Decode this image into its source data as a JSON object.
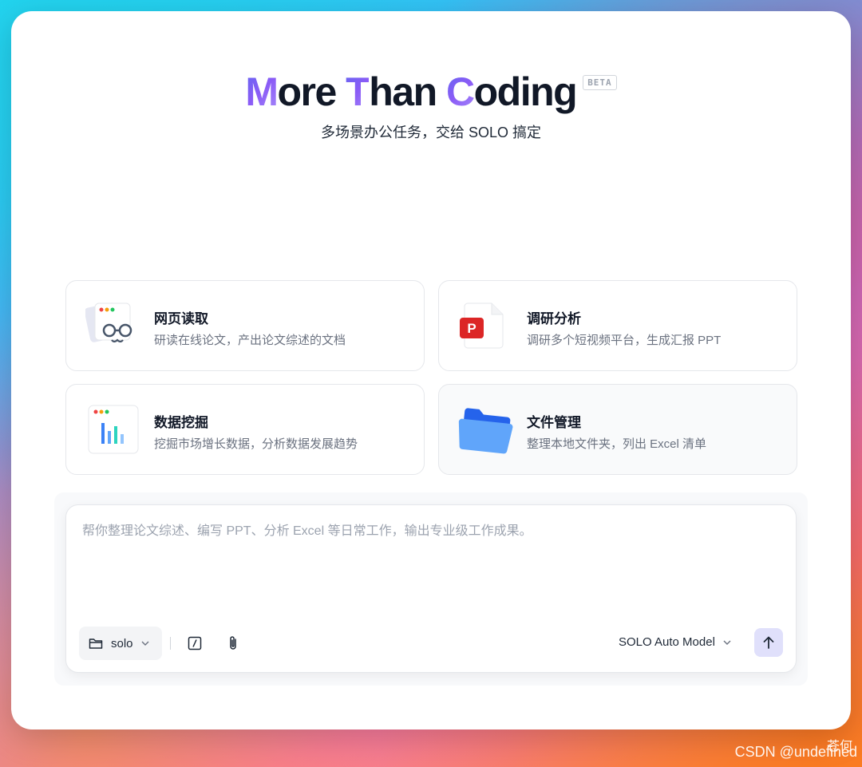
{
  "hero": {
    "title_parts": [
      {
        "accent": "M",
        "rest": "ore "
      },
      {
        "accent": "T",
        "rest": "han "
      },
      {
        "accent": "C",
        "rest": "oding"
      }
    ],
    "badge": "BETA",
    "subtitle": "多场景办公任务，交给 SOLO 搞定"
  },
  "cards": [
    {
      "title": "网页读取",
      "desc": "研读在线论文，产出论文综述的文档",
      "icon": "web-reader-icon"
    },
    {
      "title": "调研分析",
      "desc": "调研多个短视频平台，生成汇报 PPT",
      "icon": "ppt-icon"
    },
    {
      "title": "数据挖掘",
      "desc": "挖掘市场增长数据，分析数据发展趋势",
      "icon": "bar-chart-icon"
    },
    {
      "title": "文件管理",
      "desc": "整理本地文件夹，列出 Excel 清单",
      "icon": "folder-icon"
    }
  ],
  "input": {
    "placeholder": "帮你整理论文综述、编写 PPT、分析 Excel 等日常工作，输出专业级工作成果。",
    "value": ""
  },
  "toolbar": {
    "folder_label": "solo",
    "model_label": "SOLO Auto Model"
  },
  "watermark": "CSDN @undefined",
  "watermark_overlay": "苍何",
  "colors": {
    "accent": "#6366f1",
    "send_bg": "#e0e0fb"
  }
}
